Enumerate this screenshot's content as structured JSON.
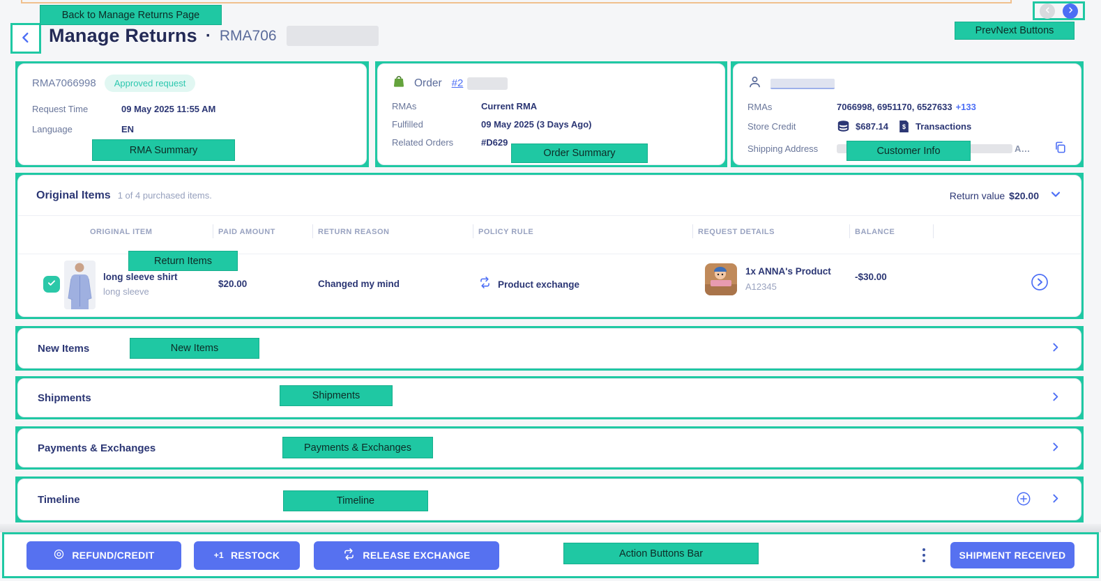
{
  "annotations": {
    "back": "Back to Manage Returns Page",
    "prevnext": "PrevNext Buttons",
    "rma_summary": "RMA Summary",
    "order_summary": "Order Summary",
    "customer_info": "Customer Info",
    "return_items": "Return Items",
    "new_items": "New Items",
    "shipments": "Shipments",
    "payments": "Payments & Exchanges",
    "timeline": "Timeline",
    "action_bar": "Action Buttons Bar"
  },
  "header": {
    "title": "Manage Returns",
    "separator": "·",
    "rma_prefix": "RMA706"
  },
  "rma_card": {
    "rma_number": "RMA7066998",
    "status": "Approved request",
    "request_time_label": "Request Time",
    "request_time": "09 May 2025 11:55 AM",
    "language_label": "Language",
    "language": "EN"
  },
  "order_card": {
    "title": "Order",
    "order_link": "#2",
    "rmas_label": "RMAs",
    "rmas": "Current RMA",
    "fulfilled_label": "Fulfilled",
    "fulfilled": "09 May 2025 (3 Days Ago)",
    "related_label": "Related Orders",
    "related": "#D629"
  },
  "customer_card": {
    "rmas_label": "RMAs",
    "rmas": "7066998, 6951170, 6527633",
    "rmas_more": "+133",
    "credit_label": "Store Credit",
    "credit_amount": "$687.14",
    "transactions_label": "Transactions",
    "address_label": "Shipping Address",
    "address_tail": "A…"
  },
  "original_items": {
    "title": "Original Items",
    "subtitle": "1 of 4 purchased items.",
    "return_value_label": "Return value",
    "return_value": "$20.00",
    "columns": [
      "ORIGINAL ITEM",
      "PAID AMOUNT",
      "RETURN REASON",
      "POLICY RULE",
      "REQUEST DETAILS",
      "BALANCE"
    ],
    "item": {
      "name": "long sleeve shirt",
      "variant": "long sleeve",
      "paid": "$20.00",
      "reason": "Changed my mind",
      "policy": "Product exchange",
      "request_name": "1x ANNA's Product",
      "request_sku": "A12345",
      "balance": "-$30.00"
    }
  },
  "sections": {
    "new_items": "New Items",
    "shipments": "Shipments",
    "payments": "Payments & Exchanges",
    "timeline": "Timeline"
  },
  "actions": {
    "refund": "REFUND/CREDIT",
    "restock": "RESTOCK",
    "restock_icon": "+1",
    "release": "RELEASE EXCHANGE",
    "shipment": "SHIPMENT RECEIVED"
  }
}
